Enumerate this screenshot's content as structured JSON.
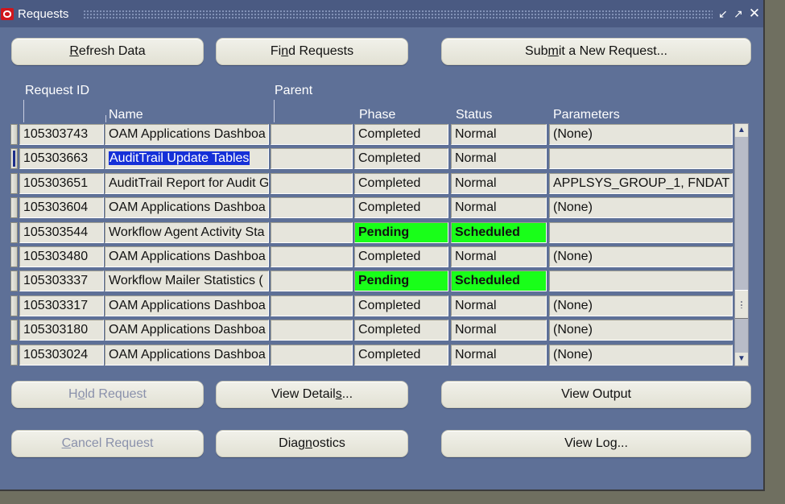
{
  "window": {
    "title": "Requests",
    "buttons": [
      "minimize",
      "maximize",
      "close"
    ]
  },
  "top_buttons": {
    "refresh": {
      "pre": "",
      "key": "R",
      "post": "efresh Data"
    },
    "find": {
      "pre": "Fi",
      "key": "n",
      "post": "d Requests"
    },
    "submit": {
      "pre": "Sub",
      "key": "m",
      "post": "it a New Request..."
    }
  },
  "table": {
    "headers": {
      "request_id": "Request ID",
      "parent": "Parent",
      "name": "Name",
      "phase": "Phase",
      "status": "Status",
      "parameters": "Parameters"
    },
    "rows": [
      {
        "id": "105303743",
        "name": "OAM Applications Dashboa",
        "parent": "",
        "phase": "Completed",
        "status": "Normal",
        "params": "(None)",
        "highlight": false
      },
      {
        "id": "105303663",
        "name": "AuditTrail Update Tables",
        "parent": "",
        "phase": "Completed",
        "status": "Normal",
        "params": "",
        "highlight": false
      },
      {
        "id": "105303651",
        "name": "AuditTrail Report for Audit G",
        "parent": "",
        "phase": "Completed",
        "status": "Normal",
        "params": "APPLSYS_GROUP_1, FNDAT",
        "highlight": false
      },
      {
        "id": "105303604",
        "name": "OAM Applications Dashboa",
        "parent": "",
        "phase": "Completed",
        "status": "Normal",
        "params": "(None)",
        "highlight": false
      },
      {
        "id": "105303544",
        "name": "Workflow Agent Activity Sta",
        "parent": "",
        "phase": "Pending",
        "status": "Scheduled",
        "params": "",
        "highlight": true
      },
      {
        "id": "105303480",
        "name": "OAM Applications Dashboa",
        "parent": "",
        "phase": "Completed",
        "status": "Normal",
        "params": "(None)",
        "highlight": false
      },
      {
        "id": "105303337",
        "name": "Workflow Mailer Statistics (",
        "parent": "",
        "phase": "Pending",
        "status": "Scheduled",
        "params": "",
        "highlight": true
      },
      {
        "id": "105303317",
        "name": "OAM Applications Dashboa",
        "parent": "",
        "phase": "Completed",
        "status": "Normal",
        "params": "(None)",
        "highlight": false
      },
      {
        "id": "105303180",
        "name": "OAM Applications Dashboa",
        "parent": "",
        "phase": "Completed",
        "status": "Normal",
        "params": "(None)",
        "highlight": false
      },
      {
        "id": "105303024",
        "name": "OAM Applications Dashboa",
        "parent": "",
        "phase": "Completed",
        "status": "Normal",
        "params": "(None)",
        "highlight": false
      }
    ],
    "selected_row": 1
  },
  "bottom_buttons": {
    "hold": {
      "pre": "H",
      "key": "o",
      "post": "ld Request",
      "enabled": false
    },
    "view_details": {
      "pre": "View Detail",
      "key": "s",
      "post": "...",
      "enabled": true
    },
    "view_output": {
      "pre": "View Output",
      "key": "",
      "post": "",
      "enabled": true
    },
    "cancel": {
      "pre": "",
      "key": "C",
      "post": "ancel Request",
      "enabled": false
    },
    "diagnostics": {
      "pre": "Diag",
      "key": "n",
      "post": "ostics",
      "enabled": true
    },
    "view_log": {
      "pre": "View Log...",
      "key": "",
      "post": "",
      "enabled": true
    }
  },
  "colors": {
    "window_bg": "#5e7097",
    "titlebar": "#4a5a82",
    "pending_green": "#19ff19",
    "selection_blue": "#1530d8"
  }
}
